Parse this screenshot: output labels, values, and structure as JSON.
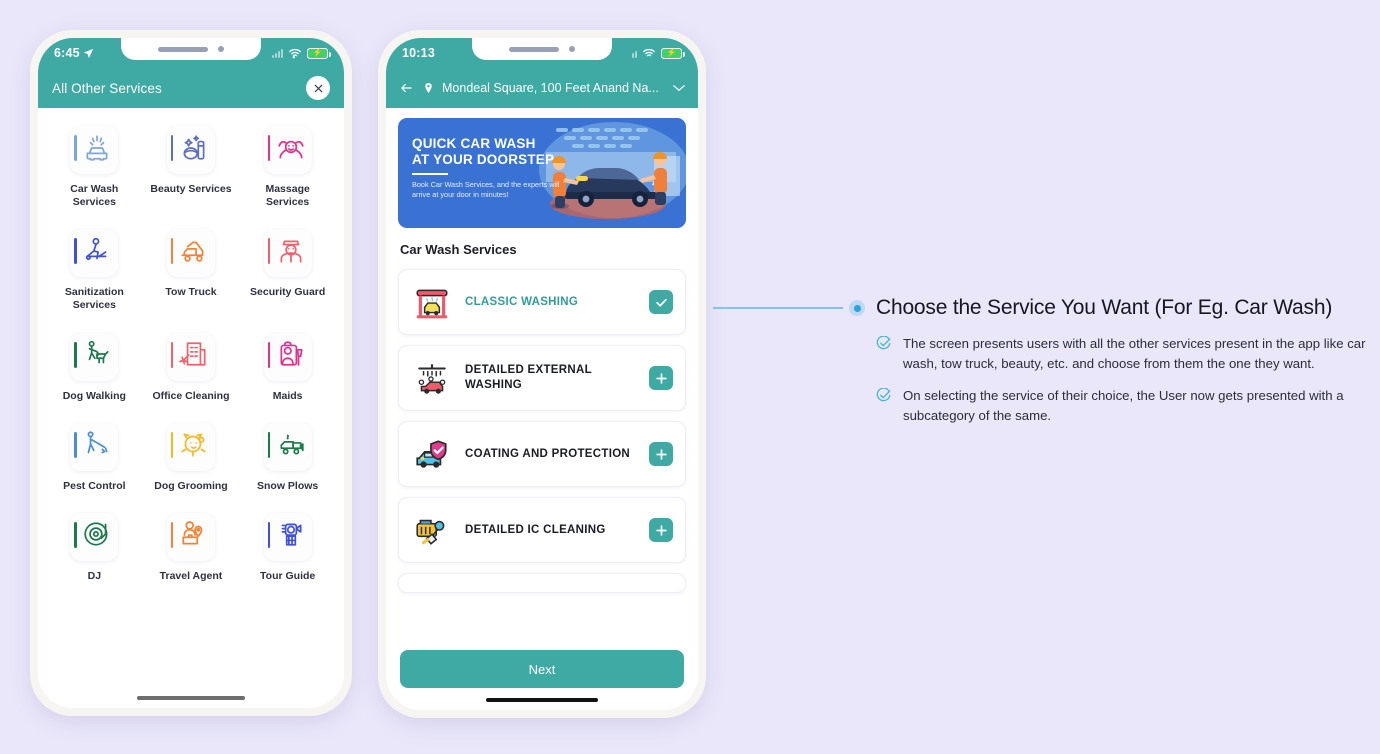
{
  "background_color": "#eae7fa",
  "accent_teal": "#3fa9a4",
  "accent_blue": "#2aa3e0",
  "left_phone": {
    "status": {
      "time": "6:45",
      "location_icon": "location-arrow-icon",
      "wifi_icon": "wifi-icon",
      "battery_icon": "battery-charging-icon"
    },
    "header": {
      "title": "All Other Services",
      "close_label": "×"
    },
    "services": [
      {
        "label": "Car Wash Services",
        "icon": "car-wash-icon",
        "color": "#7da7d9"
      },
      {
        "label": "Beauty Services",
        "icon": "beauty-icon",
        "color": "#5b6fc4"
      },
      {
        "label": "Massage Services",
        "icon": "massage-icon",
        "color": "#e0318f"
      },
      {
        "label": "Sanitization Services",
        "icon": "sanitization-icon",
        "color": "#3f51d6"
      },
      {
        "label": "Tow Truck",
        "icon": "tow-truck-icon",
        "color": "#f58232"
      },
      {
        "label": "Security Guard",
        "icon": "security-guard-icon",
        "color": "#f0616b"
      },
      {
        "label": "Dog Walking",
        "icon": "dog-walking-icon",
        "color": "#1b7a4a"
      },
      {
        "label": "Office Cleaning",
        "icon": "office-cleaning-icon",
        "color": "#f0616b"
      },
      {
        "label": "Maids",
        "icon": "maid-icon",
        "color": "#e0318f"
      },
      {
        "label": "Pest Control",
        "icon": "pest-control-icon",
        "color": "#4a8ed6"
      },
      {
        "label": "Dog Grooming",
        "icon": "dog-grooming-icon",
        "color": "#f5b81f"
      },
      {
        "label": "Snow Plows",
        "icon": "snow-plow-icon",
        "color": "#1b7a4a"
      },
      {
        "label": "DJ",
        "icon": "dj-turntable-icon",
        "color": "#1b7a4a"
      },
      {
        "label": "Travel Agent",
        "icon": "travel-agent-icon",
        "color": "#f58232"
      },
      {
        "label": "Tour Guide",
        "icon": "tour-guide-icon",
        "color": "#3f51d6"
      }
    ]
  },
  "right_phone": {
    "status": {
      "time": "10:13",
      "signal_icon": "signal-icon",
      "wifi_icon": "wifi-icon",
      "battery_icon": "battery-charging-icon"
    },
    "header": {
      "back_icon": "arrow-left-icon",
      "pin_icon": "location-pin-icon",
      "address": "Mondeal Square, 100 Feet Anand Na...",
      "chevron_icon": "chevron-down-icon"
    },
    "banner": {
      "headline": "QUICK CAR WASH\nAT YOUR DOORSTEP",
      "headline_line1": "QUICK CAR WASH",
      "headline_line2": "AT YOUR DOORSTEP",
      "subtext": "Book Car Wash Services, and the experts will arrive at your door in minutes!",
      "bg_color": "#3a72d4"
    },
    "section_title": "Car Wash Services",
    "items": [
      {
        "name": "CLASSIC WASHING",
        "icon": "car-wash-arch-icon",
        "selected": true,
        "action": "check"
      },
      {
        "name": "DETAILED EXTERNAL WASHING",
        "icon": "shower-car-icon",
        "selected": false,
        "action": "plus"
      },
      {
        "name": "COATING AND PROTECTION",
        "icon": "car-shield-icon",
        "selected": false,
        "action": "plus"
      },
      {
        "name": "DETAILED IC CLEANING",
        "icon": "engine-cleaning-icon",
        "selected": false,
        "action": "plus"
      }
    ],
    "next_label": "Next"
  },
  "annotation": {
    "heading": "Choose the Service You Want (For Eg. Car Wash)",
    "bullets": [
      "The screen presents users with all the other services present in the app like car wash, tow truck, beauty, etc. and choose from them the one they want.",
      "On selecting the service of their choice, the User now gets presented with a subcategory of the same."
    ]
  }
}
